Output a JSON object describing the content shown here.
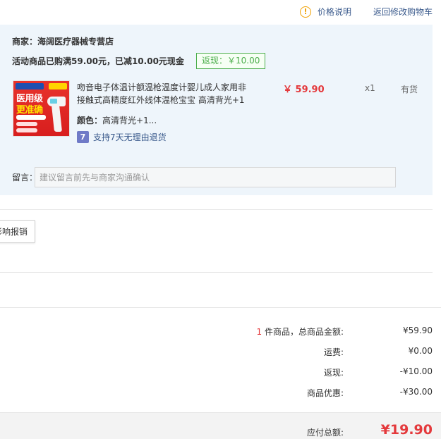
{
  "top_links": {
    "price_info_icon": "exclamation-circle-icon",
    "price_info_label": "价格说明",
    "back_to_cart_label": "返回修改购物车"
  },
  "shop": {
    "name": "商家：海阔医疗器械专营店",
    "promo_text": "活动商品已购满59.00元，已减10.00元现金",
    "promo_tag": "返现：￥10.00"
  },
  "product": {
    "thumb_icon": "thermometer-gun-product-image",
    "title": "吻音电子体温计额温枪温度计婴儿成人家用非接触式高精度红外线体温枪宝宝 高清背光+1",
    "price": "￥ 59.90",
    "quantity": "x1",
    "stock": "有货",
    "color_label": "颜色：",
    "color_value": "高清背光+1...",
    "return_icon": "seven-day-return-icon",
    "return_policy": "支持7天无理由退货"
  },
  "message": {
    "label": "留言：",
    "placeholder": "建议留言前先与商家沟通确认"
  },
  "reimburse_button": "影响报销",
  "summary": {
    "item_count": "1",
    "items_label": " 件商品，总商品金额:",
    "items_value": "¥59.90",
    "shipping_label": "运费:",
    "shipping_value": "¥0.00",
    "cashback_label": "返现:",
    "cashback_value": "-¥10.00",
    "discount_label": "商品优惠:",
    "discount_value": "-¥30.00",
    "total_label": "应付总额:",
    "total_value": "¥19.90"
  },
  "colors": {
    "accent_red": "#e4393c",
    "link_blue": "#3a5a8c",
    "panel_bg": "#eef5fb",
    "promo_green": "#4cae4c"
  }
}
